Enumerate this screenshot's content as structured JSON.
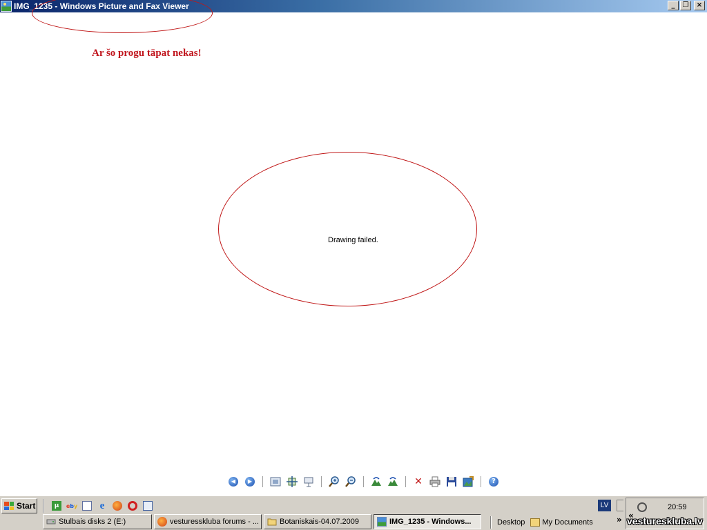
{
  "window": {
    "title": "IMG_1235 - Windows Picture and Fax Viewer",
    "buttons": {
      "minimize": "_",
      "restore": "❐",
      "close": "×"
    }
  },
  "annotation": {
    "caption": "Ar šo progu tāpat nekas!",
    "color": "#c0141c"
  },
  "viewer": {
    "message": "Drawing failed."
  },
  "viewer_toolbar": {
    "icons": [
      "previous-image-icon",
      "next-image-icon",
      "best-fit-icon",
      "actual-size-icon",
      "slideshow-icon",
      "zoom-in-icon",
      "zoom-out-icon",
      "rotate-clockwise-icon",
      "rotate-counterclockwise-icon",
      "delete-icon",
      "print-icon",
      "save-icon",
      "edit-icon",
      "help-icon"
    ]
  },
  "taskbar": {
    "start_label": "Start",
    "tasks": [
      {
        "label": "Stulbais disks 2 (E:)"
      },
      {
        "label": "vesturesskluba forums - ..."
      },
      {
        "label": "Botaniskais-04.07.2009"
      },
      {
        "label": "IMG_1235 - Windows..."
      }
    ],
    "links": {
      "desktop": "Desktop",
      "my_documents": "My Documents"
    },
    "language": "LV",
    "clock": "20:59",
    "chevron_left": "«",
    "chevron_right": "»"
  },
  "watermark": "vestureskluba.lv"
}
